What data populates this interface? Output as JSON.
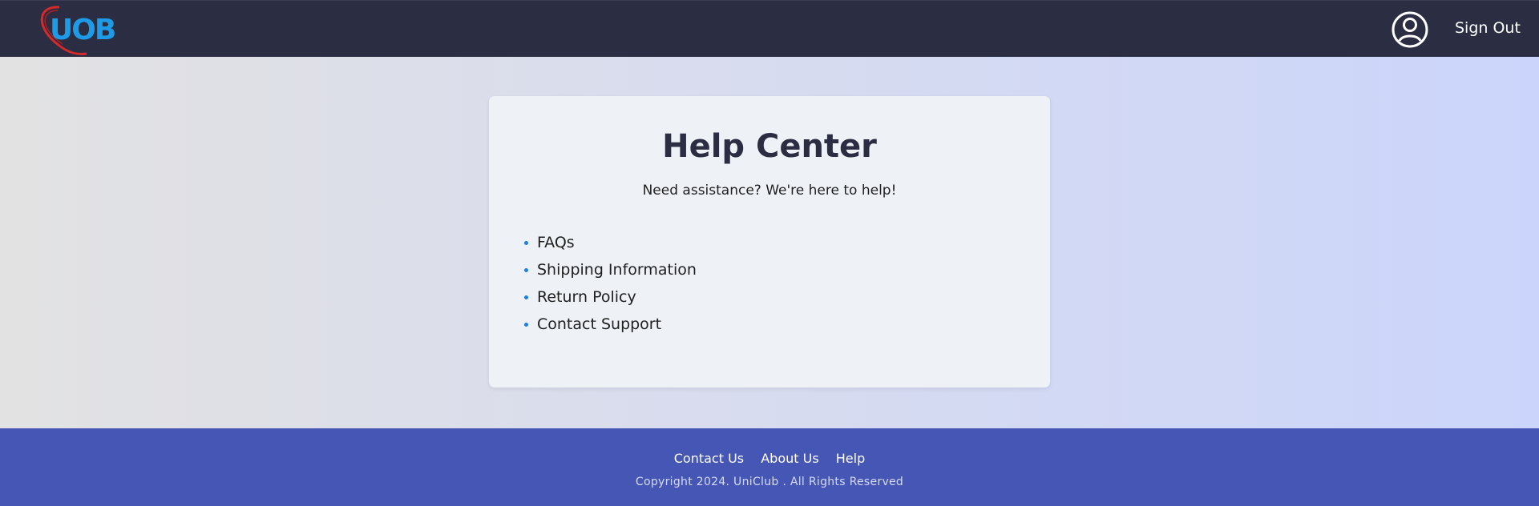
{
  "header": {
    "logo_text": "UOB",
    "signout_label": "Sign Out"
  },
  "help": {
    "title": "Help Center",
    "subtitle": "Need assistance? We're here to help!",
    "items": [
      "FAQs",
      "Shipping Information",
      "Return Policy",
      "Contact Support"
    ]
  },
  "footer": {
    "links": [
      "Contact Us",
      "About Us",
      "Help"
    ],
    "copyright": "Copyright 2024. UniClub . All Rights Reserved"
  },
  "colors": {
    "header_bg": "#2b2d42",
    "footer_bg": "#4556b5",
    "card_bg": "#eef1f6",
    "bullet": "#1e7fe0",
    "logo_blue": "#1e9be6",
    "logo_red": "#d42a2a"
  }
}
